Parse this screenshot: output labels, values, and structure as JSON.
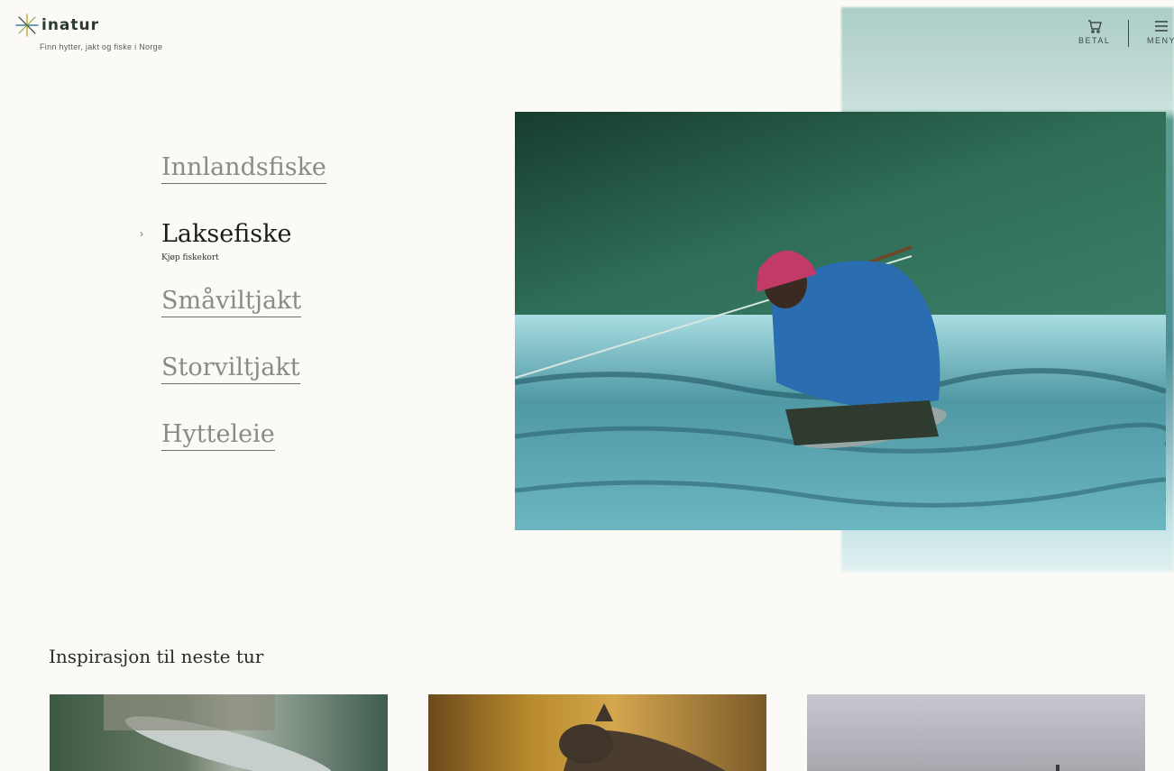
{
  "brand": {
    "name": "inatur",
    "tagline": "Finn hytter, jakt og fiske i Norge"
  },
  "header": {
    "cart": {
      "label": "BETAL",
      "icon": "cart-icon"
    },
    "menu": {
      "label": "MENY",
      "icon": "menu-icon"
    }
  },
  "nav": {
    "items": [
      {
        "label": "Innlandsfiske"
      },
      {
        "label": "Laksefiske",
        "sub": "Kjøp fiskekort",
        "active": true
      },
      {
        "label": "Småviltjakt"
      },
      {
        "label": "Storviltjakt"
      },
      {
        "label": "Hytteleie"
      }
    ]
  },
  "inspiration": {
    "title": "Inspirasjon til neste tur"
  },
  "colors": {
    "background": "#fbfaf6",
    "text_dark": "#1c1c1c",
    "text_muted": "#8a8a8a",
    "accent": "#3c4a46"
  }
}
